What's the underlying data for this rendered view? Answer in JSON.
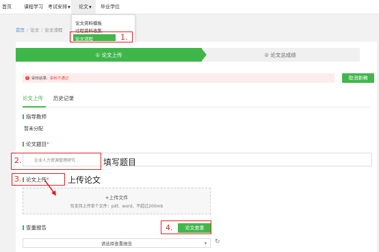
{
  "nav": {
    "items": [
      "首页",
      "课程学习",
      "考试安排",
      "论文",
      "毕业学位"
    ],
    "active": "论文"
  },
  "dropdown": {
    "items": [
      "论文资料模板",
      "过程资料收集",
      "论文流程"
    ],
    "selected": "论文流程"
  },
  "breadcrumb": [
    "首页",
    "论文",
    "论文流程"
  ],
  "steps": [
    {
      "label": "① 论文上传",
      "active": true
    },
    {
      "label": "② 论文总成绩",
      "active": false
    }
  ],
  "alert": {
    "label": "审核结果:",
    "value": "审核不通过"
  },
  "cancel_button": "取消新稿",
  "tabs": [
    "论文上传",
    "历史记录"
  ],
  "advisor": {
    "label": "指导教师",
    "value": "暂未分配"
  },
  "thesis_title": {
    "label": "论文题目",
    "required": "*",
    "value": "企业人力资源管理研究"
  },
  "upload": {
    "label": "论文上传",
    "required": "*",
    "title": "+上传文件",
    "hint": "仅支持上传单个文件：pdf、word，不超过200mb"
  },
  "check": {
    "label": "查重报告",
    "button": "论文查重",
    "select_placeholder": "请选择查重报告"
  },
  "annotations": {
    "step1": "1.",
    "step2": "2.",
    "step2_note": "填写题目",
    "step3": "3.",
    "step3_note": "上传论文",
    "step4": "4."
  },
  "colors": {
    "accent": "#3fb64a",
    "error": "#e44444",
    "annotation": "#e02020"
  }
}
